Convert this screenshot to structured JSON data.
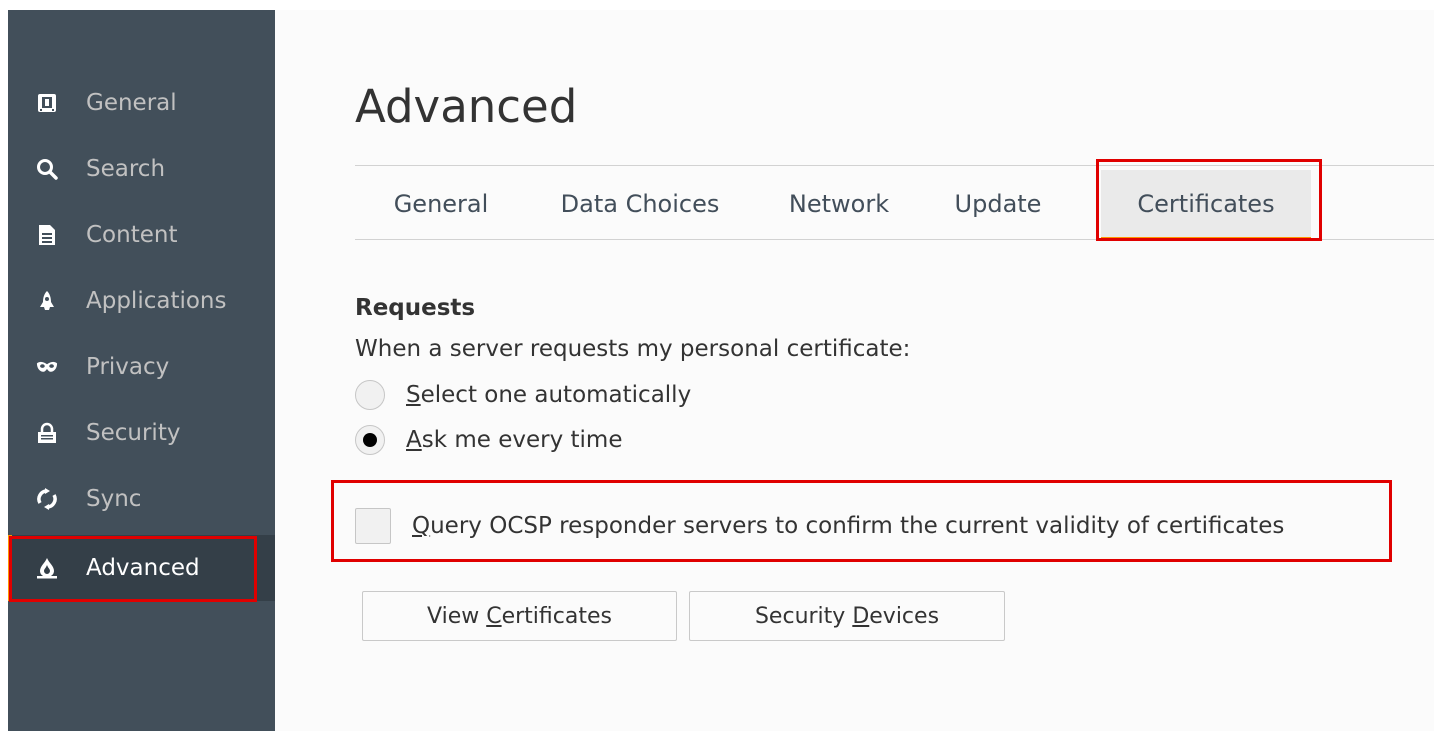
{
  "sidebar": {
    "items": [
      {
        "label": "General",
        "icon": "general-icon"
      },
      {
        "label": "Search",
        "icon": "search-icon"
      },
      {
        "label": "Content",
        "icon": "content-icon"
      },
      {
        "label": "Applications",
        "icon": "applications-icon"
      },
      {
        "label": "Privacy",
        "icon": "privacy-icon"
      },
      {
        "label": "Security",
        "icon": "security-icon"
      },
      {
        "label": "Sync",
        "icon": "sync-icon"
      },
      {
        "label": "Advanced",
        "icon": "advanced-icon",
        "selected": true
      }
    ]
  },
  "main": {
    "title": "Advanced",
    "tabs": [
      {
        "label": "General"
      },
      {
        "label": "Data Choices"
      },
      {
        "label": "Network"
      },
      {
        "label": "Update"
      },
      {
        "label": "Certificates",
        "selected": true
      }
    ],
    "requests": {
      "heading": "Requests",
      "description": "When a server requests my personal certificate:",
      "option_auto": {
        "accesskey": "S",
        "rest": "elect one automatically",
        "checked": false
      },
      "option_ask": {
        "accesskey": "A",
        "rest": "sk me every time",
        "checked": true
      }
    },
    "ocsp": {
      "accesskey": "Q",
      "rest": "uery OCSP responder servers to confirm the current validity of certificates",
      "checked": false
    },
    "buttons": {
      "view_certificates": {
        "before": "View ",
        "accesskey": "C",
        "after": "ertificates"
      },
      "security_devices": {
        "before": "Security ",
        "accesskey": "D",
        "after": "evices"
      }
    }
  },
  "colors": {
    "sidebar_bg": "#424f5a",
    "selected_bg": "#343f48",
    "accent": "#ff9500",
    "highlight_box": "#e00000"
  }
}
